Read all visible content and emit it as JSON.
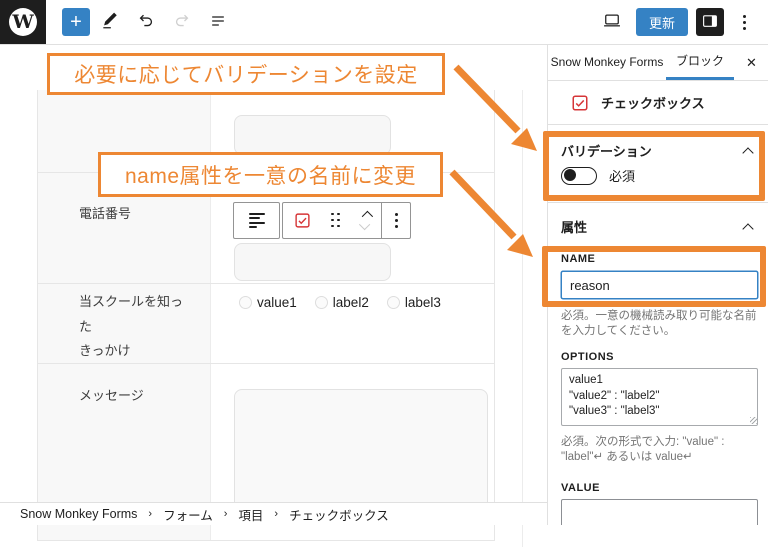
{
  "colors": {
    "accent_orange": "#ED8733",
    "wp_blue": "#3582C4",
    "alert_red": "#D63638"
  },
  "icons": {
    "wordpress_w": "W",
    "plus": "+",
    "close": "✕"
  },
  "topbar": {
    "update_button": "更新"
  },
  "canvas": {
    "callout_validation": "必要に応じてバリデーションを設定",
    "callout_name": "name属性を一意の名前に変更",
    "form": {
      "phone_label": "電話番号",
      "school_label_line1": "当スクールを知った",
      "school_label_line2": "きっかけ",
      "school_options": [
        "value1",
        "label2",
        "label3"
      ],
      "message_label": "メッセージ"
    }
  },
  "breadcrumb": {
    "items": [
      "Snow Monkey Forms",
      "フォーム",
      "項目",
      "チェックボックス"
    ],
    "separator": "›"
  },
  "sidebar": {
    "tab_plugin": "Snow Monkey Forms",
    "tab_block": "ブロック",
    "block_card_title": "チェックボックス",
    "validation_panel": {
      "title": "バリデーション",
      "required_toggle_label": "必須"
    },
    "attributes_panel": {
      "title": "属性",
      "name_label": "NAME",
      "name_value": "reason",
      "name_help": "必須。一意の機械読み取り可能な名前を入力してください。",
      "options_label": "OPTIONS",
      "options_value": "value1\n\"value2\" : \"label2\"\n\"value3\" : \"label3\"",
      "options_help": "必須。次の形式で入力: \"value\" : \"label\"↵ あるいは value↵",
      "value_label": "VALUE"
    }
  }
}
